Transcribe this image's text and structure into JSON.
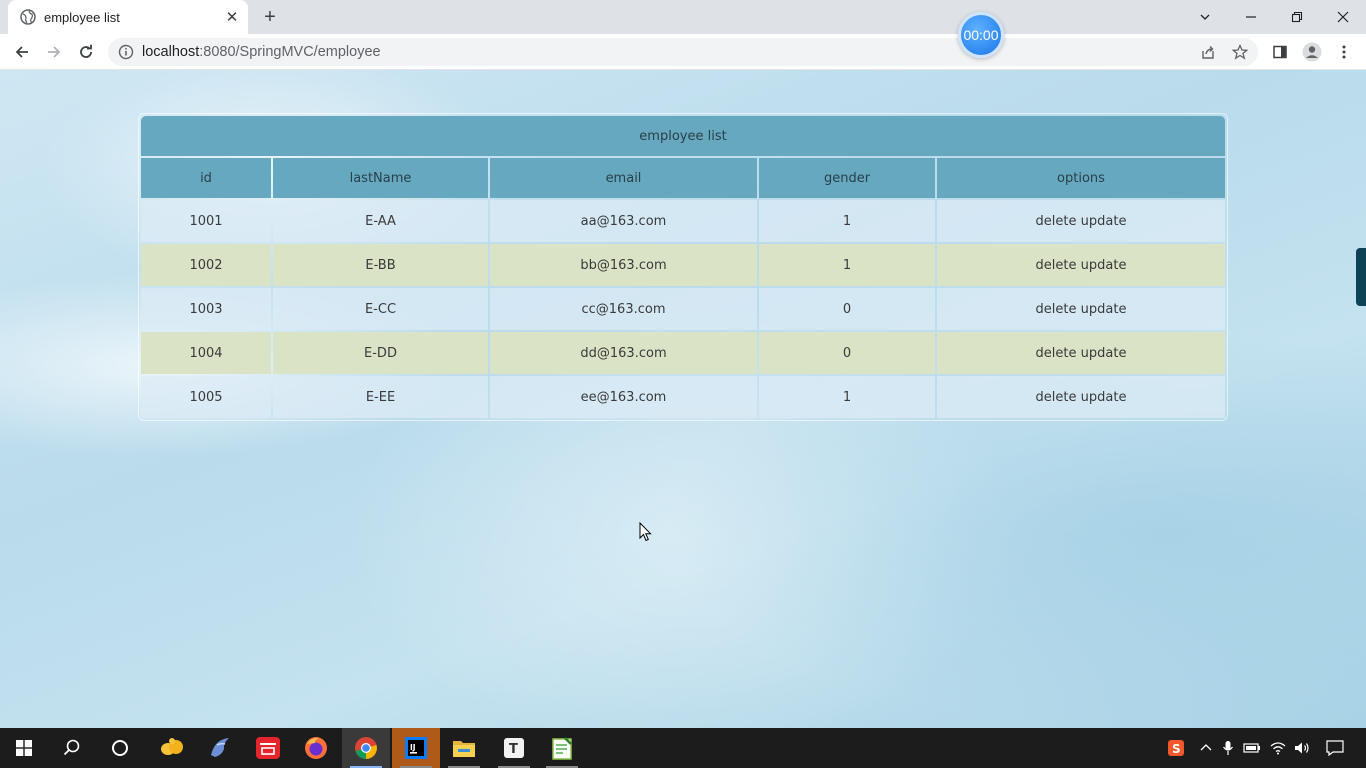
{
  "browser": {
    "tab_title": "employee list",
    "new_tab_symbol": "+",
    "url_host": "localhost",
    "url_rest": ":8080/SpringMVC/employee",
    "timer": "00:00"
  },
  "table": {
    "title": "employee list",
    "headers": [
      "id",
      "lastName",
      "email",
      "gender",
      "options"
    ],
    "rows": [
      {
        "id": "1001",
        "lastName": "E-AA",
        "email": "aa@163.com",
        "gender": "1",
        "options": "delete update"
      },
      {
        "id": "1002",
        "lastName": "E-BB",
        "email": "bb@163.com",
        "gender": "1",
        "options": "delete update"
      },
      {
        "id": "1003",
        "lastName": "E-CC",
        "email": "cc@163.com",
        "gender": "0",
        "options": "delete update"
      },
      {
        "id": "1004",
        "lastName": "E-DD",
        "email": "dd@163.com",
        "gender": "0",
        "options": "delete update"
      },
      {
        "id": "1005",
        "lastName": "E-EE",
        "email": "ee@163.com",
        "gender": "1",
        "options": "delete update"
      }
    ]
  },
  "colors": {
    "header_bg": "#66a8bf",
    "row_alt_bg": "#dbe3c6",
    "row_bg": "#dcebf5"
  },
  "taskbar": {
    "apps": [
      "windows-start-icon",
      "search-icon",
      "cortana-icon",
      "baidu-netdisk-icon",
      "dolphin-icon",
      "youdao-dict-icon",
      "firefox-icon",
      "chrome-icon",
      "intellij-idea-icon",
      "file-explorer-icon",
      "typora-icon",
      "notepad-plus-icon"
    ],
    "tray": [
      "sogou-input-icon",
      "chevron-up-icon",
      "microphone-icon",
      "battery-icon",
      "network-icon",
      "volume-icon",
      "notification-icon"
    ]
  }
}
